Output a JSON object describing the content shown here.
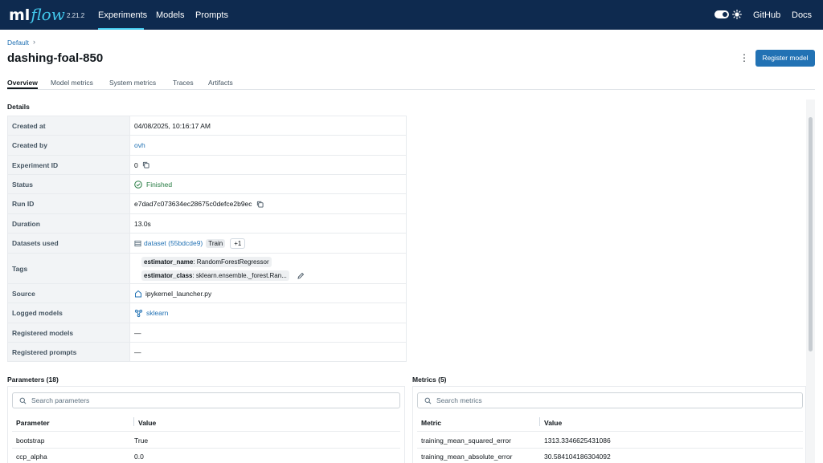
{
  "nav": {
    "logo_ml": "ml",
    "logo_flow": "flow",
    "version": "2.21.2",
    "links": [
      "Experiments",
      "Models",
      "Prompts"
    ],
    "github": "GitHub",
    "docs": "Docs",
    "accent_color": "#43c9ed",
    "bg_color": "#0e2a4f"
  },
  "header": {
    "breadcrumb": "Default",
    "breadcrumb_sep": "›",
    "title": "dashing-foal-850",
    "register_button": "Register model"
  },
  "tabs": [
    "Overview",
    "Model metrics",
    "System metrics",
    "Traces",
    "Artifacts"
  ],
  "details": {
    "title": "Details",
    "rows": {
      "created_at": {
        "label": "Created at",
        "value": "04/08/2025, 10:16:17 AM"
      },
      "created_by": {
        "label": "Created by",
        "value": "ovh"
      },
      "experiment_id": {
        "label": "Experiment ID",
        "value": "0"
      },
      "status": {
        "label": "Status",
        "value": "Finished"
      },
      "run_id": {
        "label": "Run ID",
        "value": "e7dad7c073634ec28675c0defce2b9ec"
      },
      "duration": {
        "label": "Duration",
        "value": "13.0s"
      },
      "datasets": {
        "label": "Datasets used",
        "value": "dataset (55bdcde9)",
        "badge": "Train",
        "more": "+1"
      },
      "tags": {
        "label": "Tags",
        "items": [
          {
            "key": "estimator_name",
            "value": ": RandomForestRegressor"
          },
          {
            "key": "estimator_class",
            "value": ": sklearn.ensemble._forest.Ran..."
          }
        ]
      },
      "source": {
        "label": "Source",
        "value": "ipykernel_launcher.py"
      },
      "logged_models": {
        "label": "Logged models",
        "value": "sklearn"
      },
      "registered_models": {
        "label": "Registered models",
        "value": "—"
      },
      "registered_prompts": {
        "label": "Registered prompts",
        "value": "—"
      }
    }
  },
  "parameters": {
    "title": "Parameters (18)",
    "search_placeholder": "Search parameters",
    "columns": [
      "Parameter",
      "Value"
    ],
    "rows": [
      {
        "name": "bootstrap",
        "value": "True"
      },
      {
        "name": "ccp_alpha",
        "value": "0.0"
      }
    ]
  },
  "metrics": {
    "title": "Metrics (5)",
    "search_placeholder": "Search metrics",
    "columns": [
      "Metric",
      "Value"
    ],
    "rows": [
      {
        "name": "training_mean_squared_error",
        "value": "1313.3346625431086"
      },
      {
        "name": "training_mean_absolute_error",
        "value": "30.584104186304092"
      }
    ]
  }
}
